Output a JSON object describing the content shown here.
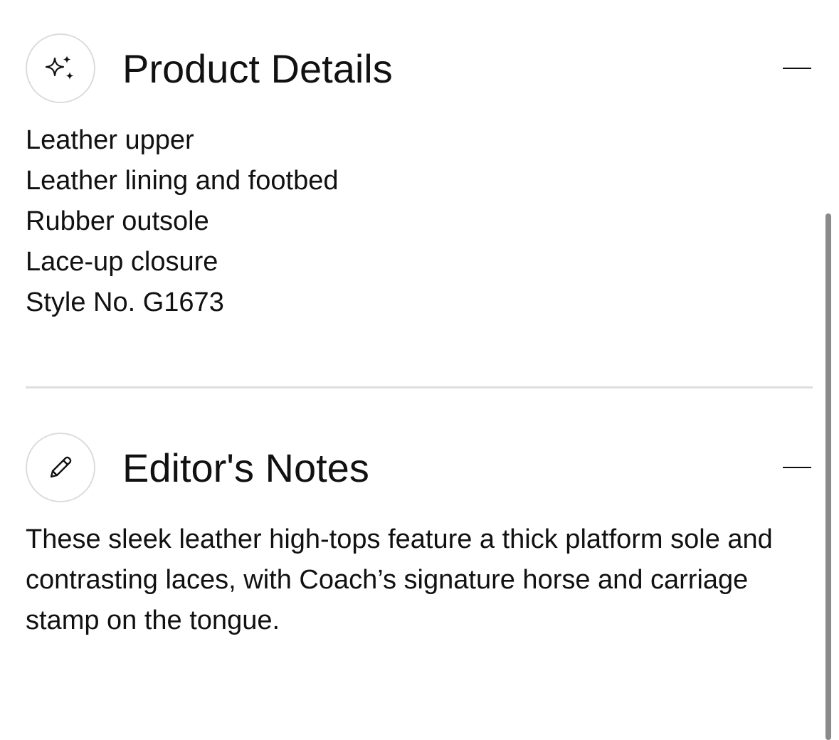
{
  "product_details": {
    "title": "Product Details",
    "icon": "sparkles-icon",
    "items": [
      "Leather upper",
      "Leather lining and footbed",
      "Rubber outsole",
      "Lace-up closure",
      "Style No. G1673"
    ]
  },
  "editors_notes": {
    "title": "Editor's Notes",
    "icon": "pencil-icon",
    "body": "These sleek leather high-tops feature a thick platform sole and contrasting laces, with Coach’s signature horse and carriage stamp on the tongue."
  },
  "colors": {
    "text": "#111111",
    "divider": "#dedede",
    "icon_border": "#dcdcdc",
    "scrollbar": "#8a8a8a"
  }
}
